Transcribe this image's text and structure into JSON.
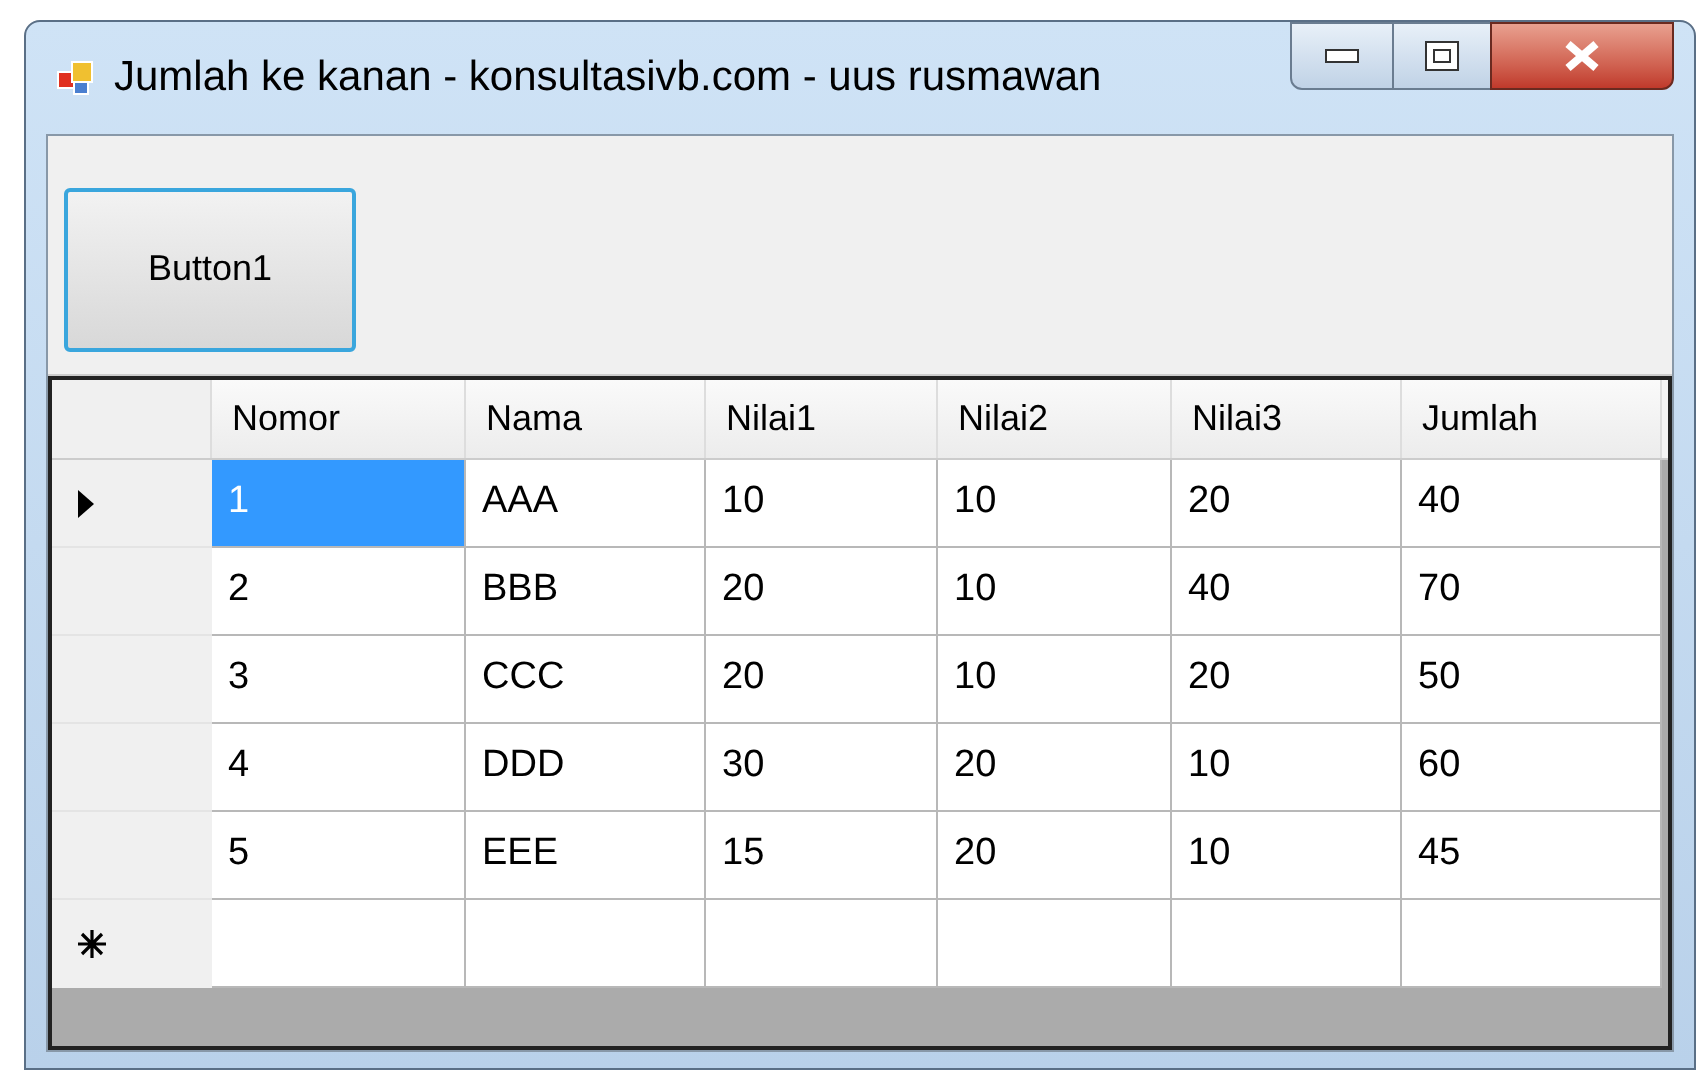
{
  "window": {
    "title": "Jumlah ke kanan - konsultasivb.com - uus rusmawan"
  },
  "button": {
    "label": "Button1",
    "focused": true
  },
  "table": {
    "columns": [
      "Nomor",
      "Nama",
      "Nilai1",
      "Nilai2",
      "Nilai3",
      "Jumlah"
    ],
    "rows": [
      {
        "selected": true,
        "cells": [
          "1",
          "AAA",
          "10",
          "10",
          "20",
          "40"
        ]
      },
      {
        "selected": false,
        "cells": [
          "2",
          "BBB",
          "20",
          "10",
          "40",
          "70"
        ]
      },
      {
        "selected": false,
        "cells": [
          "3",
          "CCC",
          "20",
          "10",
          "20",
          "50"
        ]
      },
      {
        "selected": false,
        "cells": [
          "4",
          "DDD",
          "30",
          "20",
          "10",
          "60"
        ]
      },
      {
        "selected": false,
        "cells": [
          "5",
          "EEE",
          "15",
          "20",
          "10",
          "45"
        ]
      }
    ],
    "new_row": true
  }
}
